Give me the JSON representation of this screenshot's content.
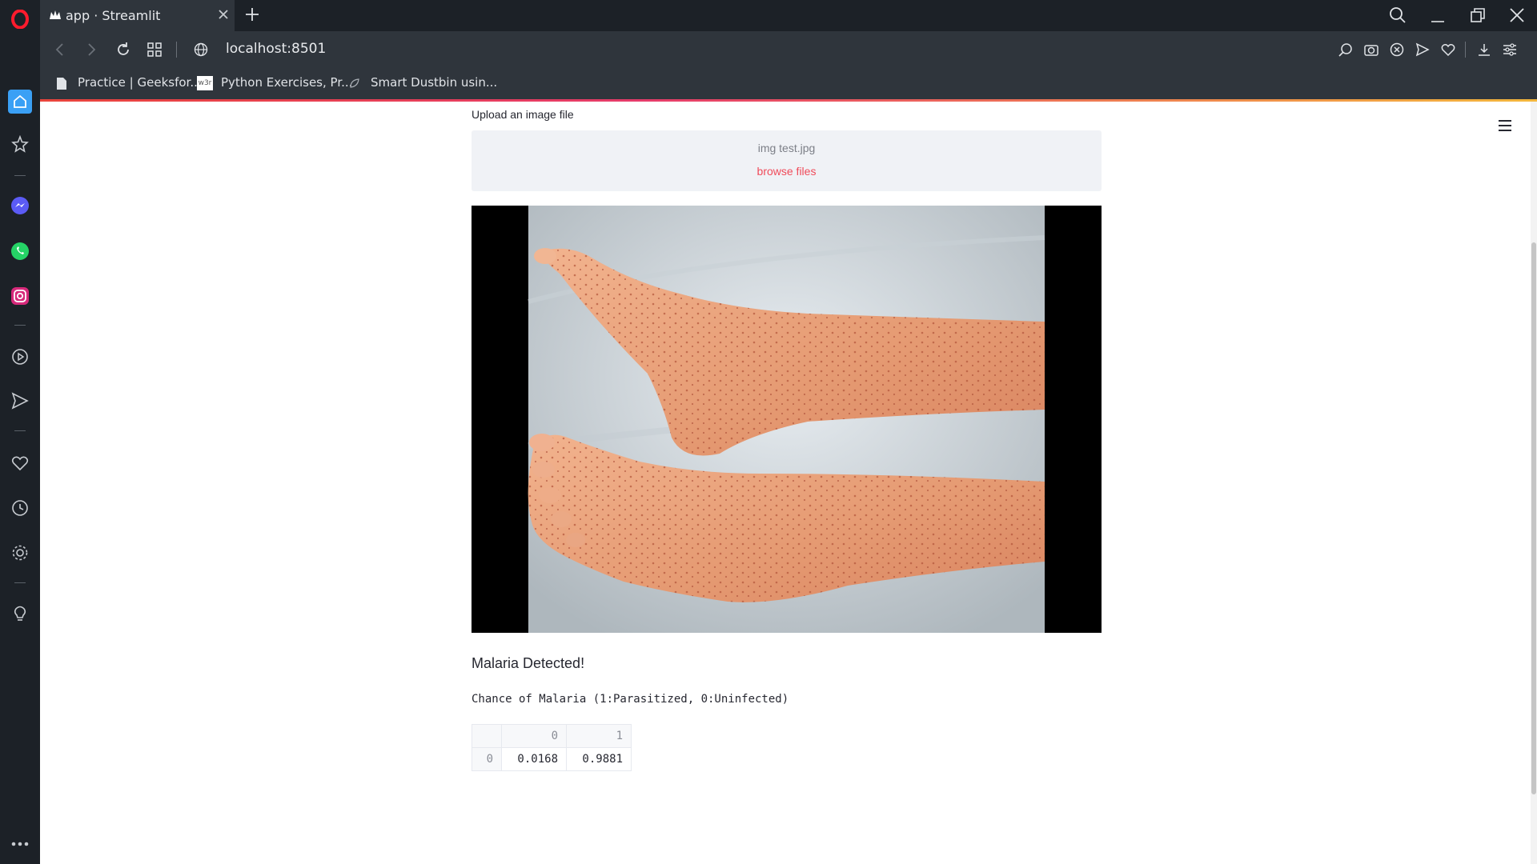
{
  "browser": {
    "tab_title": "app · Streamlit",
    "address": "localhost:8501",
    "bookmarks": [
      {
        "label": "Practice | Geeksfor..."
      },
      {
        "label": "Python Exercises, Pr..."
      },
      {
        "label": "Smart Dustbin usin..."
      }
    ],
    "bookmark_icons": [
      "document-icon",
      "w3r-icon",
      "leaf-icon"
    ]
  },
  "app": {
    "upload_label": "Upload an image file",
    "uploaded_filename": "img test.jpg",
    "browse_label": "browse files",
    "result_text": "Malaria Detected!",
    "caption": "Chance of Malaria (1:Parasitized, 0:Uninfected)",
    "table": {
      "columns": [
        "",
        "0",
        "1"
      ],
      "rows": [
        {
          "index": "0",
          "values": [
            "0.0168",
            "0.9881"
          ]
        }
      ]
    }
  },
  "colors": {
    "accent": "#f04b5a",
    "sidebar_bg": "#1c2127",
    "toolbar_bg": "#2f353c"
  }
}
